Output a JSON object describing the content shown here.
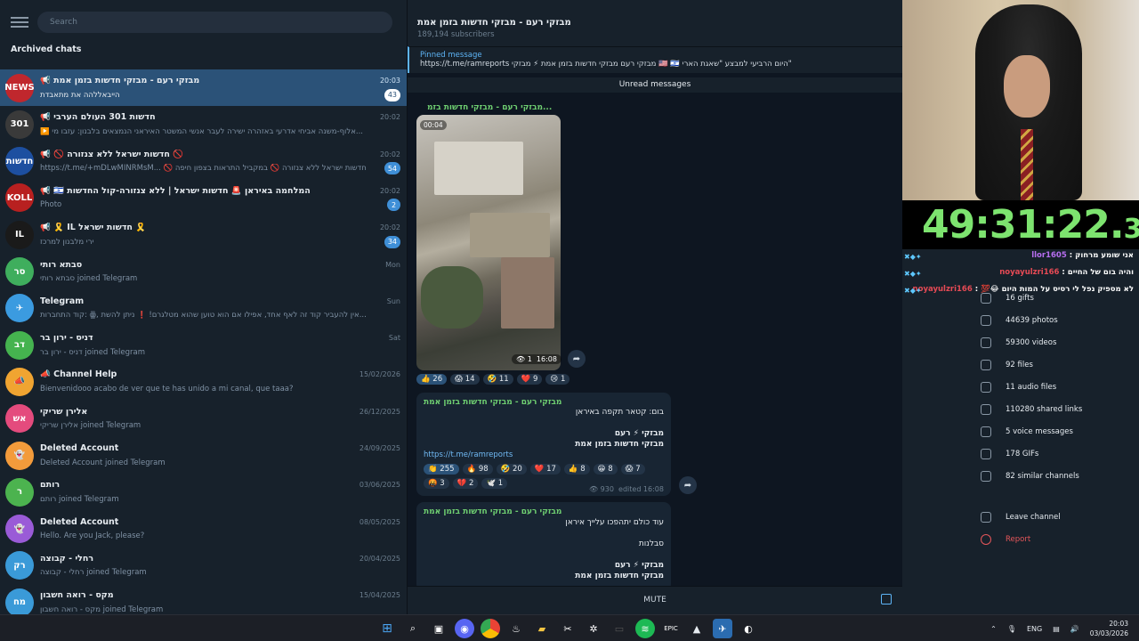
{
  "search": {
    "placeholder": "Search"
  },
  "archived_label": "Archived chats",
  "chats": [
    {
      "name": "📢 מבזקי רעם - מבזקי חדשות בזמן אמת",
      "time": "20:03",
      "msg": "הייבאללהה את מתאבדת",
      "badge": "43",
      "avatar_text": "NEWS",
      "avatar_color": "#c0272d"
    },
    {
      "name": "📢 חדשות 301 העולם הערבי",
      "time": "20:02",
      "msg": "▶️ אלוף-משנה אביחי אדרעי באזהרה ישירה לעבר אנשי המשטר האיראני הנמצאים בלבנון: עזבו מי...",
      "badge": "",
      "avatar_text": "301",
      "avatar_color": "#3a3a3a"
    },
    {
      "name": "📢 🚫 חדשות ישראל ללא צנזורה 🚫",
      "time": "20:02",
      "msg": "https://t.me/+mDLwMINRMsM... 🚫 חדשות ישראל ללא צנזורה 🚫 במקביל התראות בצפון חיפה",
      "badge": "54",
      "avatar_text": "חדשות",
      "avatar_color": "#1d4fa0"
    },
    {
      "name": "📢 🇮🇱 המלחמה באיראן 🚨 חדשות ישראל | ללא צנזורה-קול החדשות",
      "time": "20:02",
      "msg": "Photo",
      "badge": "2",
      "avatar_text": "KOLL",
      "avatar_color": "#b82020"
    },
    {
      "name": "📢 🎗️ IL חדשות ישראל 🎗️",
      "time": "20:02",
      "msg": "ירי מלבנון למרכז",
      "badge": "34",
      "avatar_text": "IL",
      "avatar_color": "#1a1a1a"
    },
    {
      "name": "סבתא רותי",
      "time": "Mon",
      "msg": "סבתא רותי joined Telegram",
      "badge": "",
      "avatar_text": "סר",
      "avatar_color": "#3fae5d"
    },
    {
      "name": "Telegram",
      "time": "Sun",
      "msg": "קוד התחברות: ꙮ, אין להעביר קוד זה לאף אחד, אפילו אם הוא טוען שהוא מטלגרם! ❗ ניתן להשת...",
      "badge": "",
      "avatar_text": "✈",
      "avatar_color": "#3b9be0"
    },
    {
      "name": "דניס - ירון בר",
      "time": "Sat",
      "msg": "דניס - ירון בר joined Telegram",
      "badge": "",
      "avatar_text": "דב",
      "avatar_color": "#45b34f"
    },
    {
      "name": "📣 Channel Help",
      "time": "15/02/2026",
      "msg": "Bienvenidooo acabo de ver que te has unido a mi canal, que taaa?",
      "badge": "",
      "avatar_text": "📣",
      "avatar_color": "#f0a431"
    },
    {
      "name": "אלירן שריקי",
      "time": "26/12/2025",
      "msg": "אלירן שריקי joined Telegram",
      "badge": "",
      "avatar_text": "אש",
      "avatar_color": "#e44b7d"
    },
    {
      "name": "Deleted Account",
      "time": "24/09/2025",
      "msg": "Deleted Account joined Telegram",
      "badge": "",
      "avatar_text": "👻",
      "avatar_color": "#f39b3b"
    },
    {
      "name": "רותם",
      "time": "03/06/2025",
      "msg": "רותם joined Telegram",
      "badge": "",
      "avatar_text": "ר",
      "avatar_color": "#4cb34f"
    },
    {
      "name": "Deleted Account",
      "time": "08/05/2025",
      "msg": "Hello. Are you Jack, please?",
      "badge": "",
      "avatar_text": "👻",
      "avatar_color": "#9a5bd7"
    },
    {
      "name": "רחלי - קבוצה",
      "time": "20/04/2025",
      "msg": "רחלי - קבוצה joined Telegram",
      "badge": "",
      "avatar_text": "רק",
      "avatar_color": "#3a9ad8"
    },
    {
      "name": "מקס - רואה חשבון",
      "time": "15/04/2025",
      "msg": "מקס - רואה חשבון joined Telegram",
      "badge": "",
      "avatar_text": "מח",
      "avatar_color": "#3a9ad8"
    }
  ],
  "channel": {
    "title": "מבזקי רעם - מבזקי חדשות בזמן אמת",
    "subscribers": "189,194 subscribers",
    "pinned_label": "Pinned message",
    "pinned_text": "https://t.me/ramreports מבזקי רעם מבזקי חדשות בזמן אמת ⚡ מבזקי 🇺🇸 🇮🇱 היום הרביעי למבצע \"שאגת הארי\"",
    "unread_label": "Unread messages",
    "video_author": "מבזקי רעם - מבזקי חדשות בזמ...",
    "video_duration": "00:04",
    "video_views": "1",
    "video_time": "16:08",
    "video_reactions": [
      {
        "emoji": "👍",
        "count": "26",
        "own": true
      },
      {
        "emoji": "😱",
        "count": "14",
        "own": false
      },
      {
        "emoji": "🤣",
        "count": "11",
        "own": false
      },
      {
        "emoji": "❤️",
        "count": "9",
        "own": false
      },
      {
        "emoji": "😢",
        "count": "1",
        "own": false
      }
    ],
    "msg2_author": "מבזקי רעם - מבזקי חדשות בזמן אמת",
    "msg2_line1": "בום: קטאר תקפה באיראן",
    "msg2_line2": "מבזקי ⚡ רעם",
    "msg2_line3": "מבזקי חדשות בזמן אמת",
    "msg2_link": "https://t.me/ramreports",
    "msg2_reactions": [
      {
        "emoji": "👏",
        "count": "255",
        "own": true
      },
      {
        "emoji": "🔥",
        "count": "98",
        "own": false
      },
      {
        "emoji": "🤣",
        "count": "20",
        "own": false
      },
      {
        "emoji": "❤️",
        "count": "17",
        "own": false
      },
      {
        "emoji": "👍",
        "count": "8",
        "own": false
      },
      {
        "emoji": "😁",
        "count": "8",
        "own": false
      },
      {
        "emoji": "😱",
        "count": "7",
        "own": false
      },
      {
        "emoji": "🤬",
        "count": "3",
        "own": false
      },
      {
        "emoji": "💔",
        "count": "2",
        "own": false
      },
      {
        "emoji": "🕊️",
        "count": "1",
        "own": false
      }
    ],
    "msg2_views": "930",
    "msg2_edited": "edited 16:08",
    "msg3_author": "מבזקי רעם - מבזקי חדשות בזמן אמת",
    "msg3_line1": "עוד כולם יתהפכו עלייך איראן",
    "msg3_line2": "סבלנות",
    "msg3_line3": "מבזקי ⚡ רעם",
    "msg3_line4": "מבזקי חדשות בזמן אמת",
    "mute_label": "MUTE",
    "down_badge": "43"
  },
  "stream": {
    "timer_main": "49:31:22.",
    "timer_ms": "33",
    "chat_lines": [
      {
        "user": "llor1605",
        "text": "אני שומע מרחוק"
      },
      {
        "user": "noyayulzri166",
        "text": "והיה בום של החיים"
      },
      {
        "user": "noyayulzri166",
        "text": "לא מספיק נפל לי רסיס על המות היום 😂💯"
      }
    ]
  },
  "info": [
    {
      "label": "16 gifts",
      "icon": "gift-icon"
    },
    {
      "label": "44639 photos",
      "icon": "photo-icon"
    },
    {
      "label": "59300 videos",
      "icon": "video-icon"
    },
    {
      "label": "92 files",
      "icon": "file-icon"
    },
    {
      "label": "11 audio files",
      "icon": "headphones-icon"
    },
    {
      "label": "110280 shared links",
      "icon": "link-icon"
    },
    {
      "label": "5 voice messages",
      "icon": "mic-icon"
    },
    {
      "label": "178 GIFs",
      "icon": "gif-icon"
    },
    {
      "label": "82 similar channels",
      "icon": "megaphone-icon"
    },
    {
      "label": "Leave channel",
      "icon": "leave-icon"
    },
    {
      "label": "Report",
      "icon": "report-icon"
    }
  ],
  "taskbar": {
    "lang": "ENG",
    "time": "20:03",
    "date": "03/03/2026"
  }
}
